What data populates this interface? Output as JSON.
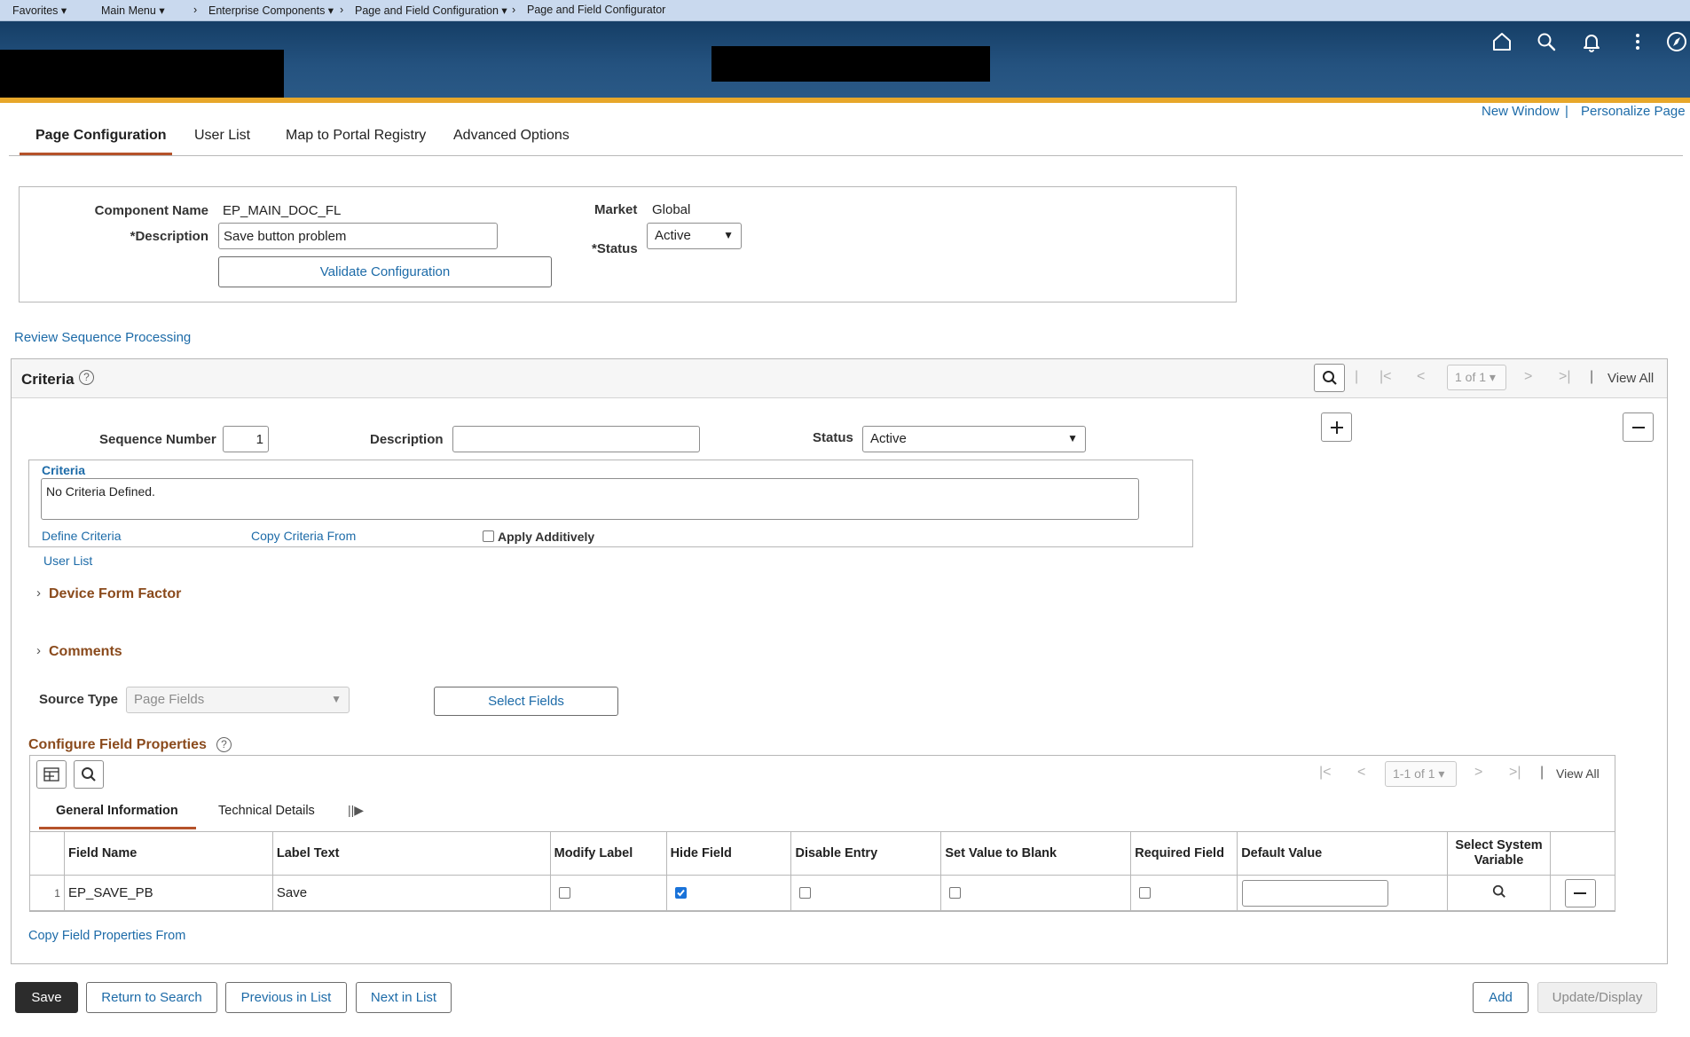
{
  "topnav": {
    "favorites": "Favorites",
    "main_menu": "Main Menu",
    "crumb1": "Enterprise Components",
    "crumb2": "Page and Field Configuration",
    "crumb3": "Page and Field Configurator"
  },
  "header_links": {
    "new_window": "New Window",
    "separator": "|",
    "personalize": "Personalize Page"
  },
  "tabs": [
    {
      "label": "Page Configuration",
      "active": true
    },
    {
      "label": "User List"
    },
    {
      "label": "Map to Portal Registry"
    },
    {
      "label": "Advanced Options"
    }
  ],
  "config": {
    "component_name_label": "Component Name",
    "component_name_value": "EP_MAIN_DOC_FL",
    "description_label": "*Description",
    "description_value": "Save button problem",
    "validate_button": "Validate Configuration",
    "market_label": "Market",
    "market_value": "Global",
    "status_label": "*Status",
    "status_value": "Active"
  },
  "review_link": "Review Sequence Processing",
  "criteria_panel": {
    "title": "Criteria",
    "page_indicator": "1 of 1",
    "view_all": "View All",
    "sequence_label": "Sequence Number",
    "sequence_value": "1",
    "description_label": "Description",
    "description_value": "",
    "status_label": "Status",
    "status_value": "Active",
    "criteria_label": "Criteria",
    "criteria_text": "No Criteria Defined.",
    "define_criteria": "Define Criteria",
    "copy_criteria": "Copy Criteria From",
    "apply_additively": "Apply Additively",
    "user_list": "User List",
    "device_form_factor": "Device Form Factor",
    "comments": "Comments",
    "source_type_label": "Source Type",
    "source_type_value": "Page Fields",
    "select_fields": "Select Fields"
  },
  "field_props": {
    "title": "Configure Field Properties",
    "page_indicator": "1-1 of 1",
    "view_all": "View All",
    "subtabs": [
      "General Information",
      "Technical Details"
    ],
    "columns": [
      "Field Name",
      "Label Text",
      "Modify Label",
      "Hide Field",
      "Disable Entry",
      "Set Value to Blank",
      "Required Field",
      "Default Value",
      "Select System Variable"
    ],
    "rows": [
      {
        "num": "1",
        "field_name": "EP_SAVE_PB",
        "label_text": "Save",
        "modify_label": false,
        "hide_field": true,
        "disable_entry": false,
        "set_blank": false,
        "required": false,
        "default_value": ""
      }
    ],
    "copy_link": "Copy Field Properties From"
  },
  "bottom": {
    "save": "Save",
    "return_search": "Return to Search",
    "previous": "Previous in List",
    "next": "Next in List",
    "add": "Add",
    "update_display": "Update/Display"
  }
}
